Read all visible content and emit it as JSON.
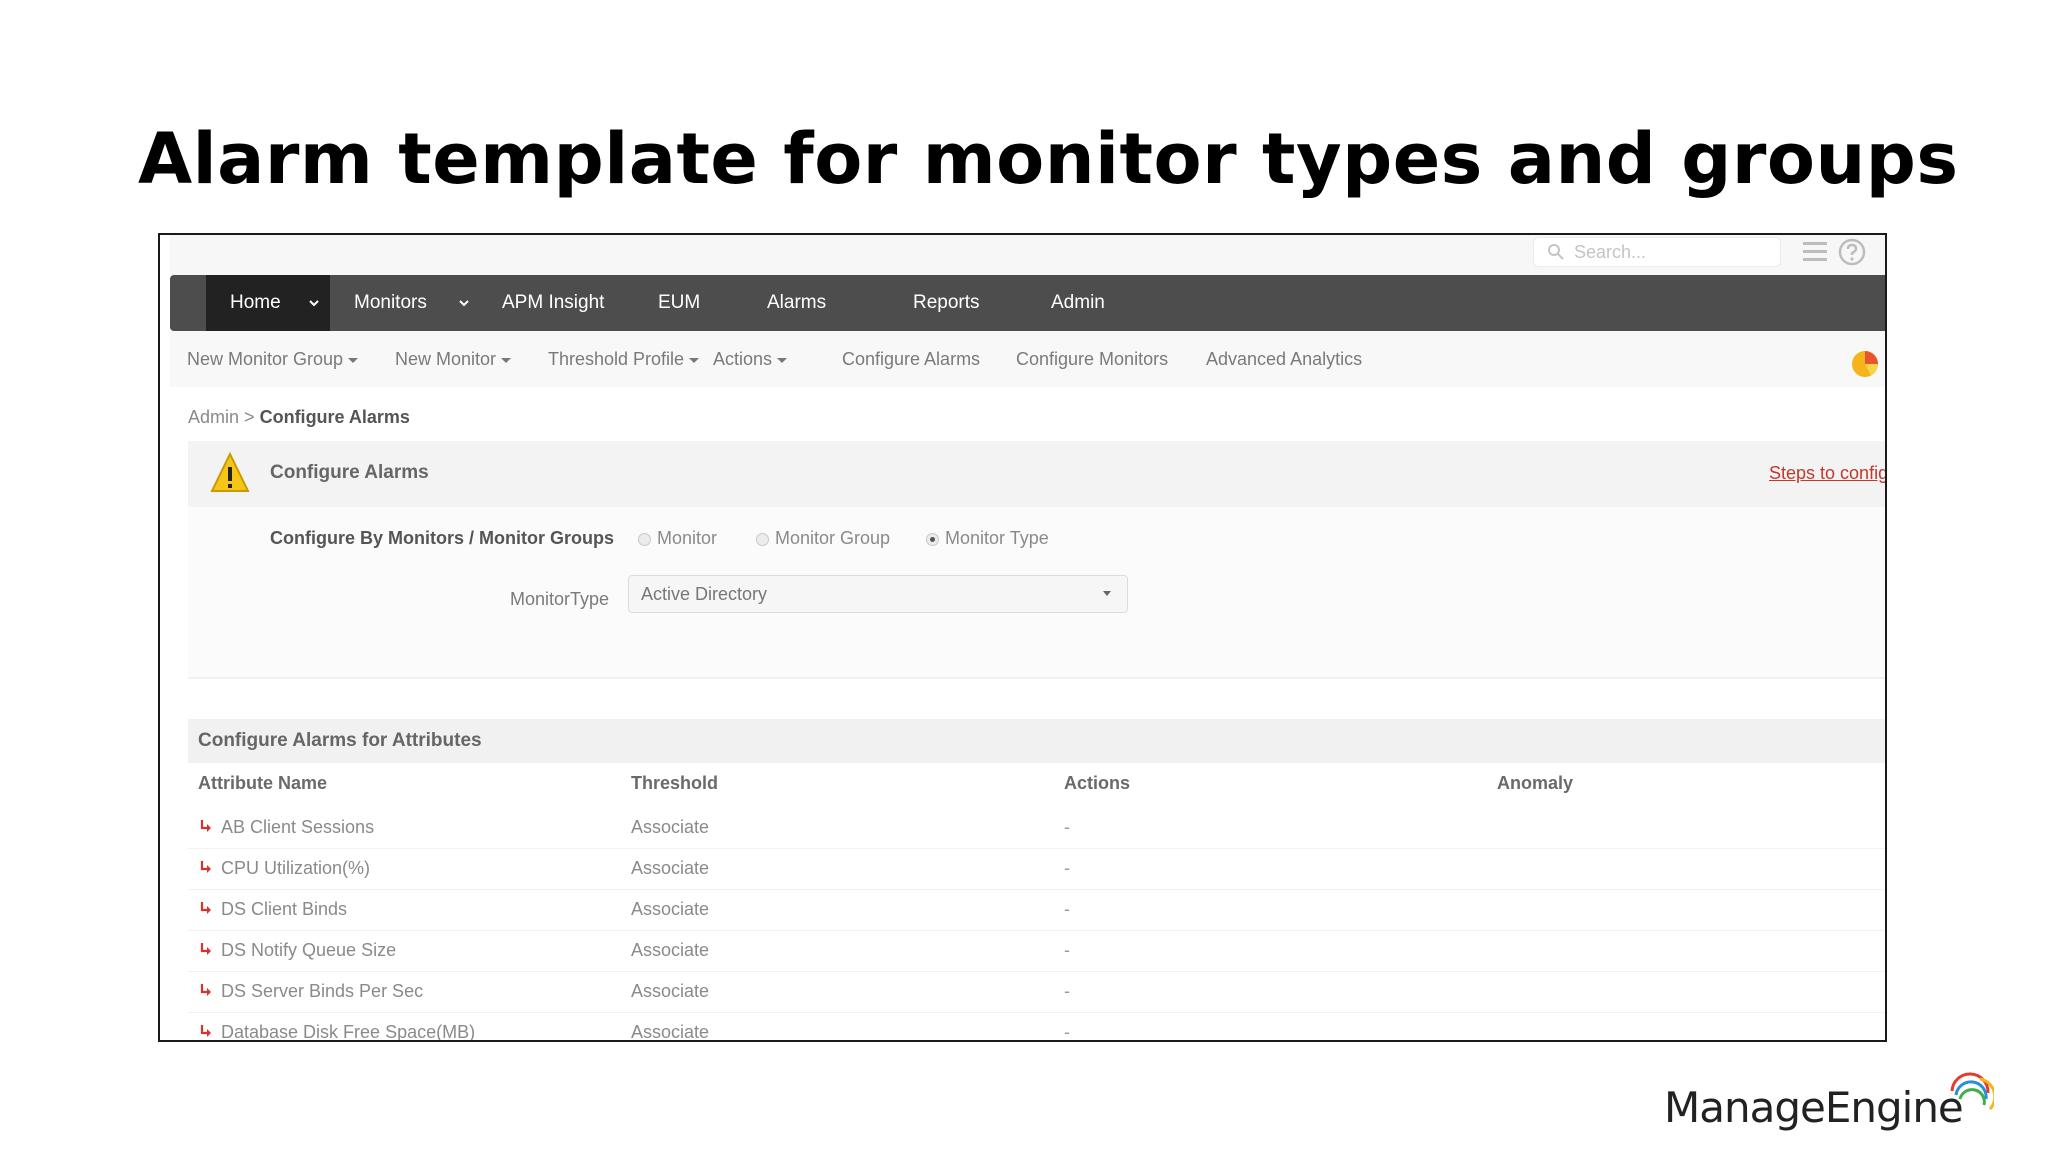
{
  "slide": {
    "title": "Alarm template for monitor types and groups"
  },
  "top_bar": {
    "search_placeholder": "Search..."
  },
  "nav": {
    "items": [
      {
        "label": "Home",
        "active": true
      },
      {
        "label": "Monitors"
      },
      {
        "label": "APM Insight"
      },
      {
        "label": "EUM"
      },
      {
        "label": "Alarms"
      },
      {
        "label": "Reports"
      },
      {
        "label": "Admin"
      }
    ]
  },
  "subnav": {
    "items": [
      {
        "label": "New Monitor Group"
      },
      {
        "label": "New Monitor"
      },
      {
        "label": "Threshold Profile"
      },
      {
        "label": "Actions"
      },
      {
        "label": "Configure Alarms"
      },
      {
        "label": "Configure Monitors"
      },
      {
        "label": "Advanced Analytics"
      }
    ]
  },
  "breadcrumb": {
    "parent": "Admin",
    "separator": ">",
    "current": "Configure Alarms"
  },
  "config_panel": {
    "title": "Configure Alarms",
    "steps_link": "Steps to configu",
    "configure_by_label": "Configure By Monitors / Monitor Groups",
    "radio_options": [
      {
        "label": "Monitor",
        "checked": false
      },
      {
        "label": "Monitor Group",
        "checked": false
      },
      {
        "label": "Monitor Type",
        "checked": true
      }
    ],
    "monitor_type_label": "MonitorType",
    "monitor_type_value": "Active Directory"
  },
  "attributes": {
    "title": "Configure Alarms for Attributes",
    "columns": [
      "Attribute Name",
      "Threshold",
      "Actions",
      "Anomaly"
    ],
    "rows": [
      {
        "name": "AB Client Sessions",
        "threshold": "Associate",
        "actions": "-"
      },
      {
        "name": "CPU Utilization(%)",
        "threshold": "Associate",
        "actions": "-"
      },
      {
        "name": "DS Client Binds",
        "threshold": "Associate",
        "actions": "-"
      },
      {
        "name": "DS Notify Queue Size",
        "threshold": "Associate",
        "actions": "-"
      },
      {
        "name": "DS Server Binds Per Sec",
        "threshold": "Associate",
        "actions": "-"
      },
      {
        "name": "Database Disk Free Space(MB)",
        "threshold": "Associate",
        "actions": "-"
      }
    ]
  },
  "footer": {
    "logo_text": "ManageEngine"
  },
  "colors": {
    "nav_bg": "#4d4d4d",
    "nav_active": "#222222",
    "link_red": "#c0392b",
    "row_arrow": "#d9342b"
  }
}
